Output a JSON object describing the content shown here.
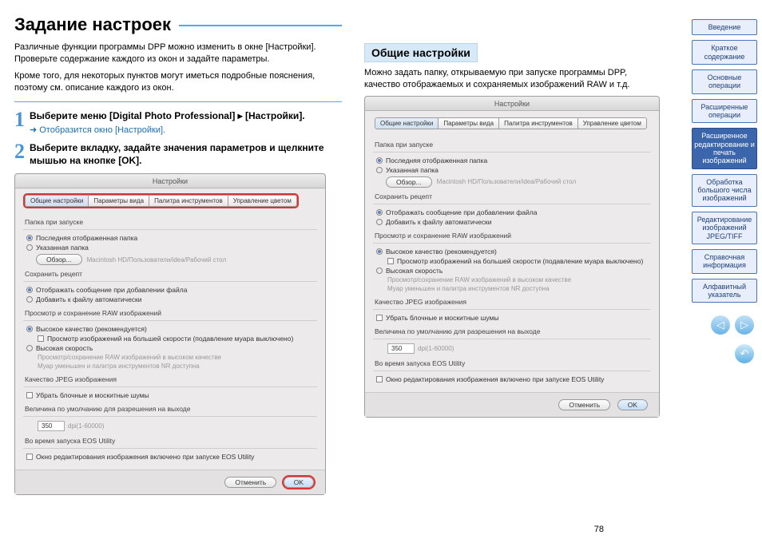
{
  "title": "Задание настроек",
  "intro1": "Различные функции программы DPP можно изменить в окне [Настройки]. Проверьте содержание каждого из окон и задайте параметры.",
  "intro2": "Кроме того, для некоторых пунктов могут иметься подробные пояснения, поэтому см. описание каждого из окон.",
  "step1": {
    "num": "1",
    "text": "Выберите меню [Digital Photo Professional] ▸ [Настройки].",
    "note": "Отобразится окно [Настройки]."
  },
  "step2": {
    "num": "2",
    "text": "Выберите вкладку, задайте значения параметров и щелкните мышью на кнопке [OK]."
  },
  "section2": {
    "title": "Общие настройки",
    "desc": "Можно задать папку, открываемую при запуске программы DPP, качество отображаемых и сохраняемых изображений RAW и т.д."
  },
  "prefs": {
    "winTitle": "Настройки",
    "tabs": [
      "Общие настройки",
      "Параметры вида",
      "Палитра инструментов",
      "Управление цветом"
    ],
    "s_folder": "Папка при запуске",
    "opt_last": "Последняя отображенная папка",
    "opt_spec": "Указанная папка",
    "browse": "Обзор...",
    "path": "Macintosh HD/Пользователи/idea/Рабочий стол",
    "s_recipe": "Сохранить рецепт",
    "opt_msg": "Отображать сообщение при добавлении файла",
    "opt_auto": "Добавить к файлу автоматически",
    "s_rawview": "Просмотр и сохранение RAW изображений",
    "opt_hq": "Высокое качество (рекомендуется)",
    "opt_hq_sub": "Просмотр изображений на большей скорости (подавление муара выключено)",
    "opt_hs": "Высокая скорость",
    "hs_l1": "Просмотр/сохранение RAW изображений в высоком качестве",
    "hs_l2": "Муар уменьшен и палитра инструментов NR доступна",
    "s_jpeg": "Качество JPEG изображения",
    "opt_noise": "Убрать блочные и москитные шумы",
    "s_res": "Величина по умолчанию для разрешения на выходе",
    "res_val": "350",
    "res_range": "dpi(1-60000)",
    "s_eos": "Во время запуска EOS Utility",
    "opt_eos": "Окно редактирования изображения включено при запуске EOS Utility",
    "btn_cancel": "Отменить",
    "btn_ok": "OK"
  },
  "sidebar": [
    "Введение",
    "Краткое содержание",
    "Основные операции",
    "Расширенные операции",
    "Расширенное редактирование и печать изображений",
    "Обработка большого числа изображений",
    "Редактирование изображений JPEG/TIFF",
    "Справочная информация",
    "Алфавитный указатель"
  ],
  "pageNum": "78"
}
